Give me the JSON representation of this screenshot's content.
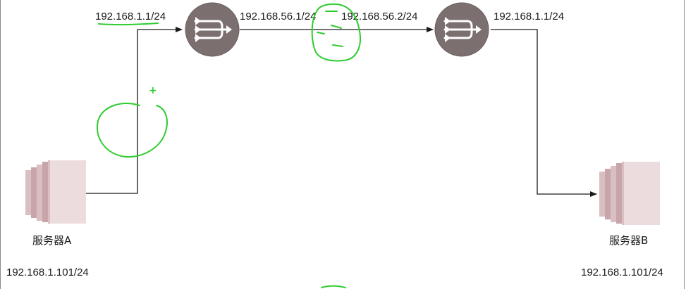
{
  "diagram": {
    "colors": {
      "router_fill": "#7c6f70",
      "router_stroke": "#6a5d5e",
      "router_arrow": "#ffffff",
      "server_light": "#eddcde",
      "server_mid": "#d9bfc2",
      "server_dark": "#c7a5a9",
      "line": "#1a1a1a",
      "annotation": "#2ecc2e"
    },
    "routers": [
      {
        "name": "router-1",
        "icon": "router-icon"
      },
      {
        "name": "router-2",
        "icon": "router-icon"
      }
    ],
    "servers": [
      {
        "label": "服务器A",
        "ip": "192.168.1.101/24",
        "icon": "server-icon"
      },
      {
        "label": "服务器B",
        "ip": "192.168.1.101/24",
        "icon": "server-icon"
      }
    ],
    "interface_labels": {
      "r1_left": "192.168.1.1/24",
      "r1_right": "192.168.56.1/24",
      "r2_left": "192.168.56.2/24",
      "r2_right": "192.168.1.1/24"
    },
    "annotations": {
      "plus": "+"
    }
  }
}
